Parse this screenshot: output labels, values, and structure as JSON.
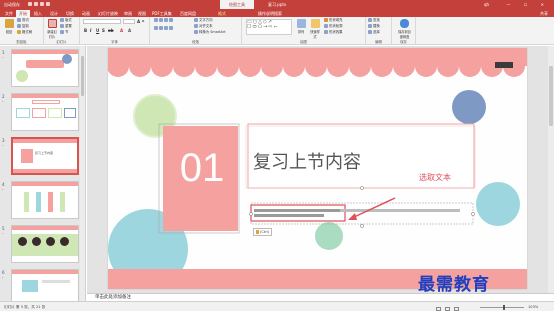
{
  "titlebar": {
    "autosave": "自动保存",
    "tool_tab": "绘图工具",
    "filename": "复习.pptx",
    "user": "qh",
    "window_buttons": "— ☐ ✕"
  },
  "tabs": [
    "文件",
    "开始",
    "插入",
    "设计",
    "切换",
    "动画",
    "幻灯片放映",
    "审阅",
    "视图",
    "PDF工具集",
    "百度网盘",
    "格式"
  ],
  "tellme": "操作说明搜索",
  "share": "共享",
  "ribbon": {
    "clipboard": {
      "label": "剪贴板",
      "paste": "粘贴",
      "cut": "剪切",
      "copy": "复制",
      "painter": "格式刷"
    },
    "slides": {
      "label": "幻灯片",
      "new": "新建幻灯片",
      "layout": "版式",
      "reset": "重置",
      "section": "节"
    },
    "font": {
      "label": "字体",
      "font_name": "",
      "font_size": ""
    },
    "paragraph": {
      "label": "段落",
      "text_dir": "文字方向",
      "align_text": "对齐文本",
      "smartart": "转换为 SmartArt"
    },
    "drawing": {
      "label": "绘图",
      "arrange": "排列",
      "quick_styles": "快速样式",
      "fill": "形状填充",
      "outline": "形状轮廓",
      "effects": "形状效果"
    },
    "editing": {
      "label": "编辑",
      "find": "查找",
      "replace": "替换",
      "select": "选择"
    },
    "save": {
      "label": "保存",
      "btn": "保存到百度网盘"
    }
  },
  "thumbnails": [
    {
      "num": "1",
      "star": "*",
      "title": "",
      "selected": false
    },
    {
      "num": "2",
      "star": "*",
      "title": "",
      "selected": false
    },
    {
      "num": "3",
      "star": "*",
      "title": "复习上节内容",
      "selected": true
    },
    {
      "num": "4",
      "star": "*",
      "title": "",
      "selected": false
    },
    {
      "num": "5",
      "star": "*",
      "title": "",
      "selected": false
    },
    {
      "num": "6",
      "star": "*",
      "title": "",
      "selected": false
    }
  ],
  "slide": {
    "number": "01",
    "title": "复习上节内容",
    "paste_options": "(Ctrl)",
    "annotation": "选取文本"
  },
  "notes": "单击此处添加备注",
  "status": {
    "left": "幻灯片 第 3 张，共 21 张",
    "zoom": "103%"
  },
  "watermark": "最需教育",
  "colors": {
    "accent": "#c4403b",
    "slide_pink": "#f4a1a0",
    "circle_blue": "#9dd6df",
    "circle_green": "#cfe6b5",
    "circle_navy": "#7f99c5",
    "annotation_red": "#e0505a",
    "watermark": "#1f3fbf"
  }
}
